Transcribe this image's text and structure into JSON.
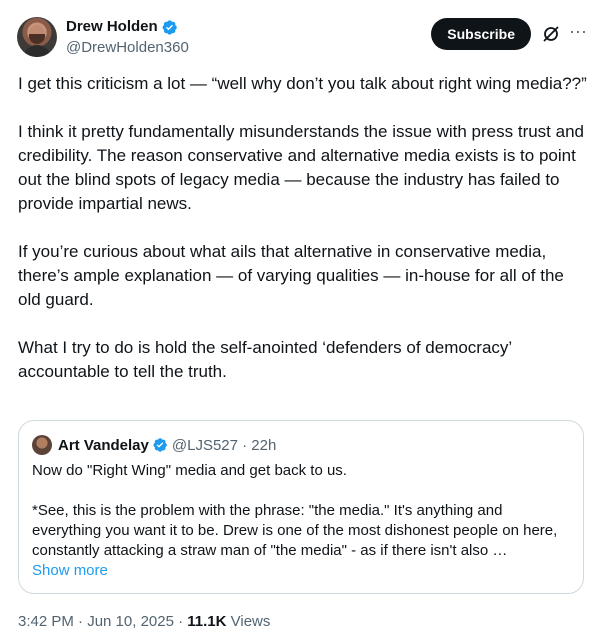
{
  "author": {
    "name": "Drew Holden",
    "handle": "@DrewHolden360"
  },
  "actions": {
    "subscribe_label": "Subscribe",
    "grok_icon": "grok-icon",
    "more_icon": "more-icon",
    "more_glyph": "···"
  },
  "tweet": {
    "paragraphs": [
      "I get this criticism a lot — “well why don’t you talk about right wing media??”",
      "I think it pretty fundamentally misunderstands the issue with press trust and credibility. The reason conservative and alternative media exists is to point out the blind spots of legacy media — because the industry has failed to provide impartial news.",
      "If you’re curious about what ails that alternative in conservative media, there’s ample explanation — of varying qualities — in-house for all of the old guard.",
      "What I try to do is hold the self-anointed ‘defenders of democracy’ accountable to tell the truth."
    ]
  },
  "quote": {
    "name": "Art Vandelay",
    "handle_time": "@LJS527 · 22h",
    "paragraphs": [
      "Now do \"Right Wing\" media and get back to us.",
      "*See, this is the problem with the phrase: \"the media.\" It's anything and everything you want it to be. Drew is one of the most dishonest people on here, constantly attacking a straw man of \"the media\" - as if there isn't also …"
    ],
    "show_more": "Show more"
  },
  "meta": {
    "datetime": "3:42 PM · Jun 10, 2025 · ",
    "views_count": "11.1K",
    "views_label": " Views"
  },
  "colors": {
    "verified": "#1d9bf0",
    "link": "#1d9bf0",
    "secondary_text": "#536471",
    "border": "#cfd9de"
  }
}
